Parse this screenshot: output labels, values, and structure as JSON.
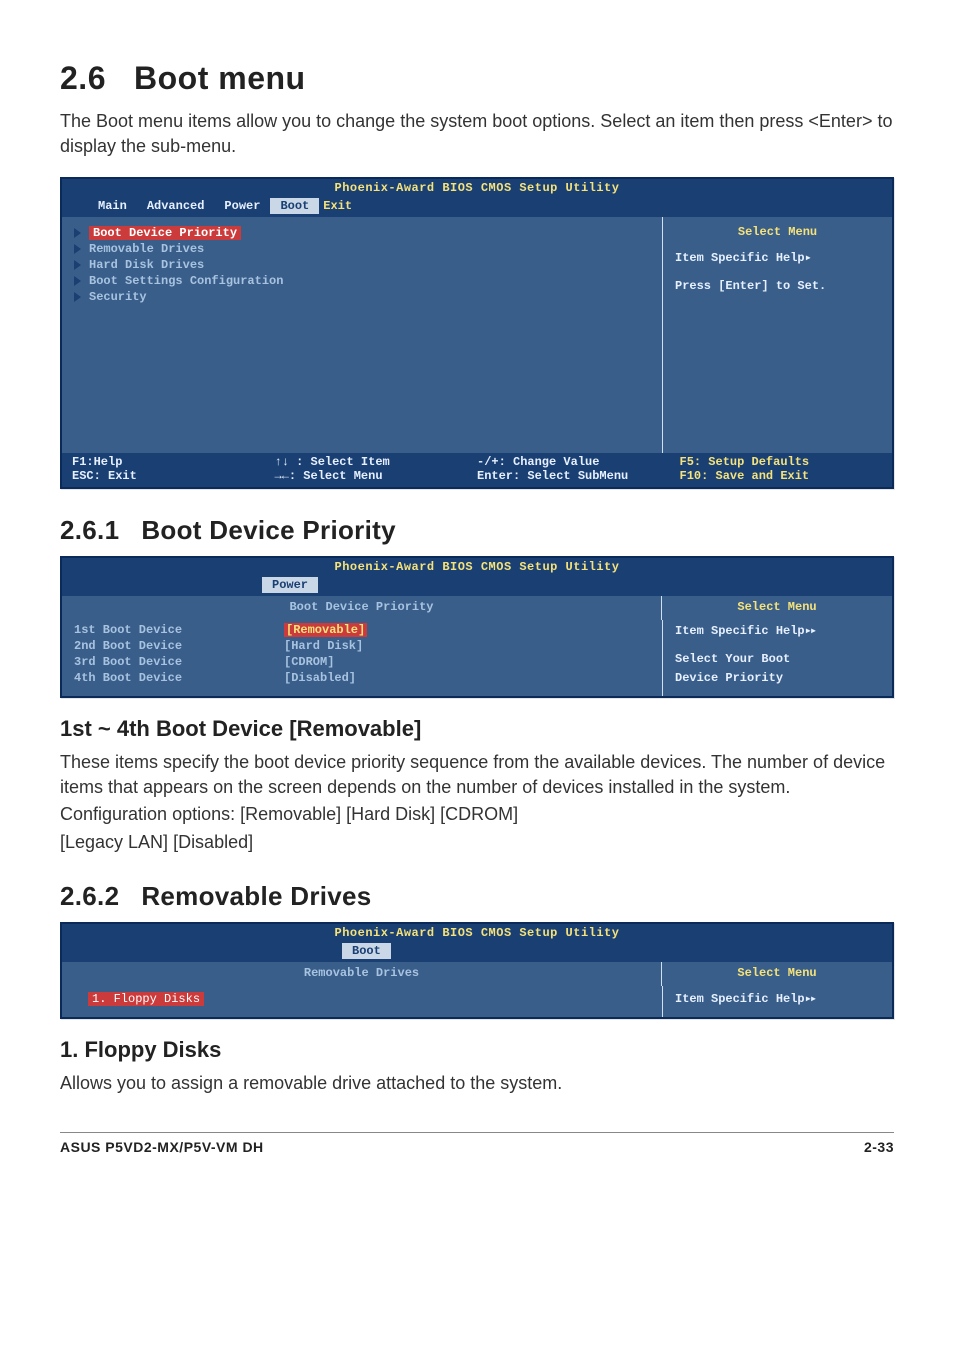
{
  "section": {
    "number": "2.6",
    "title": "Boot menu",
    "intro": "The Boot menu items allow you to change the system boot options. Select an item then press <Enter> to display the sub-menu."
  },
  "bios1": {
    "title": "Phoenix-Award BIOS CMOS Setup Utility",
    "tabs": [
      "Main",
      "Advanced",
      "Power",
      "Boot",
      "Exit"
    ],
    "items": [
      "Boot Device Priority",
      "Removable Drives",
      "Hard Disk Drives",
      "Boot Settings Configuration",
      "Security"
    ],
    "right_title": "Select Menu",
    "right_line1": "Item Specific Help",
    "right_line2": "Press [Enter] to Set.",
    "footer": {
      "c1a": "F1:Help",
      "c1b": "ESC: Exit",
      "c2a": "↑↓ : Select Item",
      "c2b": "→←: Select Menu",
      "c3a": "-/+: Change Value",
      "c3b": "Enter: Select SubMenu",
      "c4a": "F5: Setup Defaults",
      "c4b": "F10: Save and Exit"
    }
  },
  "sub261": {
    "number": "2.6.1",
    "title": "Boot Device Priority"
  },
  "bios2": {
    "title": "Phoenix-Award BIOS CMOS Setup Utility",
    "tab_label": "Power",
    "section_header": "Boot Device Priority",
    "rows": [
      {
        "label": "1st Boot Device",
        "value": "[Removable]",
        "selected": true
      },
      {
        "label": "2nd Boot Device",
        "value": "[Hard Disk]",
        "selected": false
      },
      {
        "label": "3rd Boot Device",
        "value": "[CDROM]",
        "selected": false
      },
      {
        "label": "4th Boot Device",
        "value": "[Disabled]",
        "selected": false
      }
    ],
    "right_title": "Select Menu",
    "right_line1": "Item Specific Help",
    "right_line2": "Select Your Boot",
    "right_line3": "Device Priority"
  },
  "detail1": {
    "heading": "1st ~ 4th Boot Device [Removable]",
    "p1": "These items specify the boot device priority sequence from the available devices. The number of device items that appears on the screen depends on the number of devices installed in the system.",
    "p2": "Configuration options: [Removable] [Hard Disk] [CDROM]",
    "p3": "[Legacy LAN] [Disabled]"
  },
  "sub262": {
    "number": "2.6.2",
    "title": "Removable Drives"
  },
  "bios3": {
    "title": "Phoenix-Award BIOS CMOS Setup Utility",
    "tab_label": "Boot",
    "section_header": "Removable Drives",
    "item": "1. Floppy Disks",
    "right_title": "Select Menu",
    "right_line1": "Item Specific Help"
  },
  "detail2": {
    "heading": "1. Floppy Disks",
    "p1": "Allows you to assign a removable drive attached to the system."
  },
  "footer": {
    "left": "ASUS P5VD2-MX/P5V-VM DH",
    "right": "2-33"
  }
}
